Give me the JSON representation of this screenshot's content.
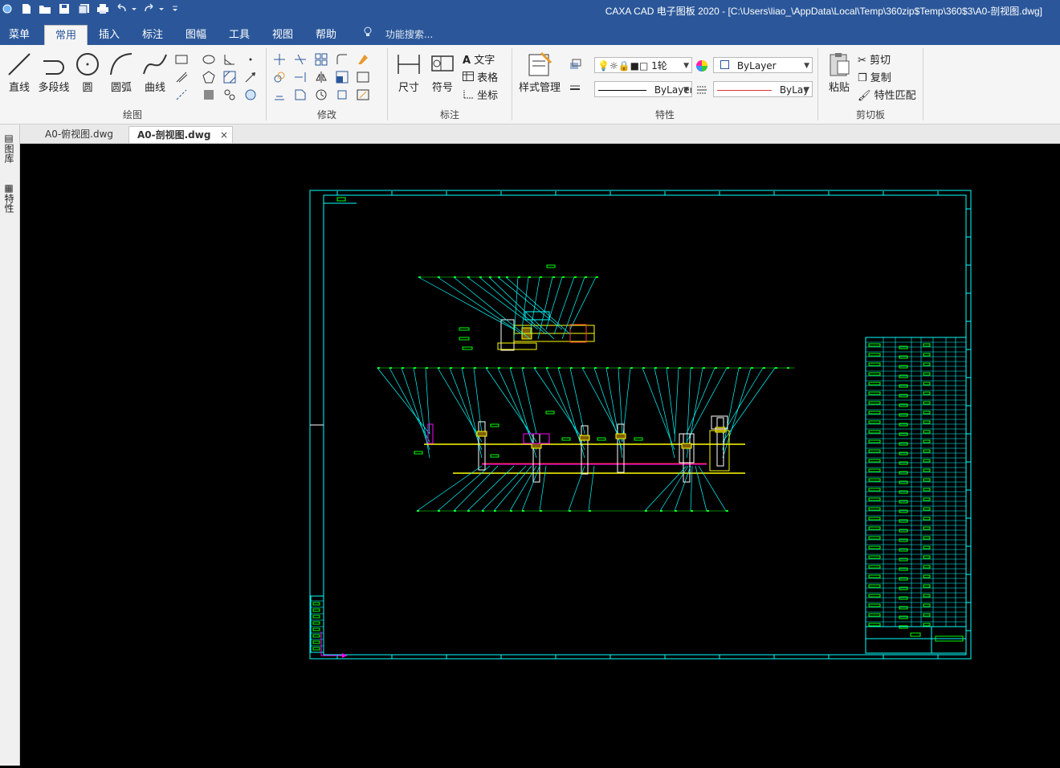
{
  "window": {
    "title": "CAXA CAD 电子图板 2020 - [C:\\Users\\liao_\\AppData\\Local\\Temp\\360zip$Temp\\360$3\\A0-剖视图.dwg]"
  },
  "menu_tabs": [
    "菜单",
    "常用",
    "插入",
    "标注",
    "图幅",
    "工具",
    "视图",
    "帮助"
  ],
  "active_menu_tab": "常用",
  "search": {
    "placeholder": "功能搜索..."
  },
  "ribbon": {
    "draw": {
      "label": "绘图",
      "line": "直线",
      "polyline": "多段线",
      "circle": "圆",
      "arc": "圆弧",
      "curve": "曲线"
    },
    "modify": {
      "label": "修改"
    },
    "annotate": {
      "label": "标注",
      "dimension": "尺寸",
      "symbol": "符号",
      "text": "文字",
      "table": "表格",
      "coordinate": "坐标"
    },
    "properties": {
      "label": "特性",
      "style_manager": "样式管理",
      "layer_value": "1轮",
      "color_value": "ByLayer",
      "linetype_value": "ByLayer",
      "lineweight_value": "ByLay"
    },
    "clipboard": {
      "label": "剪切板",
      "paste": "粘贴",
      "cut": "剪切",
      "copy": "复制",
      "match": "特性匹配"
    }
  },
  "doc_tabs": [
    {
      "name": "A0-俯视图.dwg",
      "active": false
    },
    {
      "name": "A0-剖视图.dwg",
      "active": true
    }
  ],
  "side_panels": [
    "图库",
    "特性"
  ],
  "colors": {
    "accent": "#2b579a",
    "frame": "#00ffff",
    "label": "#00ff00",
    "part": "#ffff00",
    "mark": "#ff00ff",
    "red": "#ff3333"
  }
}
